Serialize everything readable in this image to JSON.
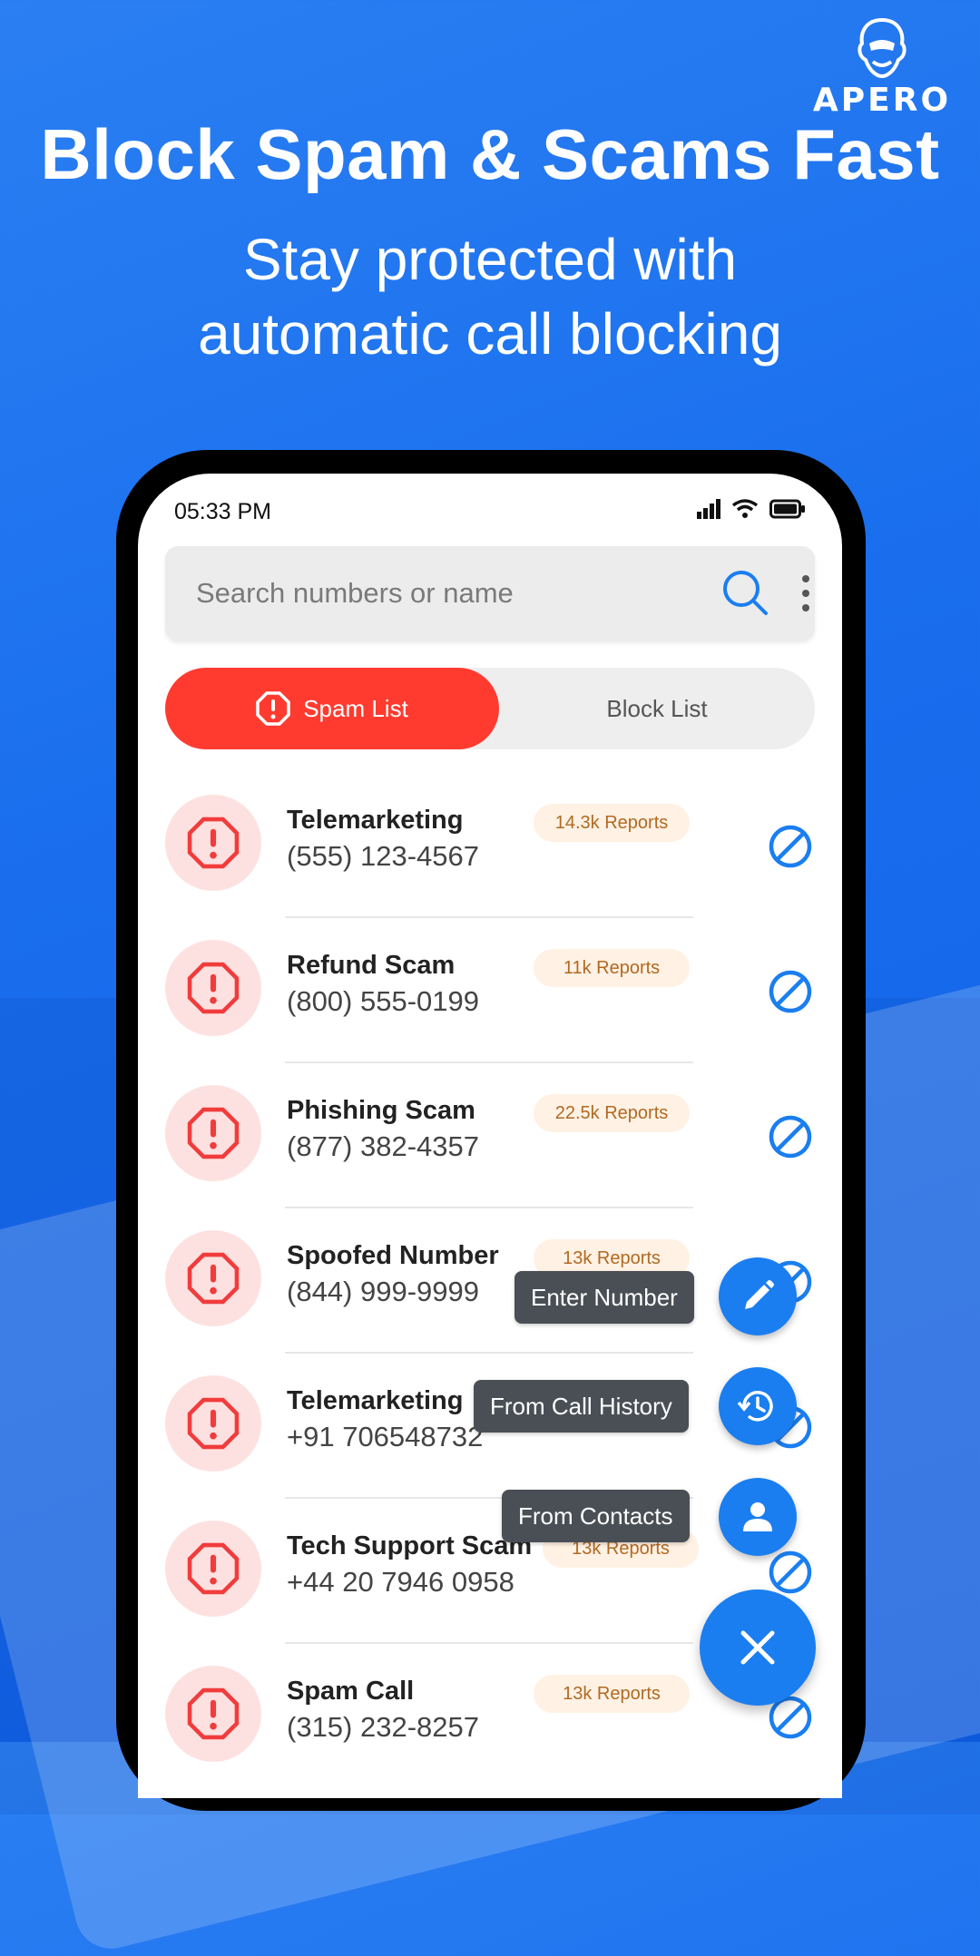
{
  "brand": {
    "name": "APERO"
  },
  "hero": {
    "headline": "Block Spam & Scams Fast",
    "subline_1": "Stay protected with",
    "subline_2": "automatic call blocking"
  },
  "status_bar": {
    "time": "05:33 PM"
  },
  "search": {
    "placeholder": "Search numbers or name"
  },
  "tabs": {
    "active": "Spam List",
    "inactive": "Block List"
  },
  "spam_list": [
    {
      "name": "Telemarketing",
      "number": "(555) 123-4567",
      "reports": "14.3k Reports"
    },
    {
      "name": "Refund Scam",
      "number": "(800) 555-0199",
      "reports": "11k Reports"
    },
    {
      "name": "Phishing Scam",
      "number": "(877) 382-4357",
      "reports": "22.5k Reports"
    },
    {
      "name": "Spoofed Number",
      "number": "(844) 999-9999",
      "reports": "13k Reports"
    },
    {
      "name": "Telemarketing",
      "number": "+91 706548732",
      "reports": ""
    },
    {
      "name": "Tech Support Scam",
      "number": "+44 20 7946 0958",
      "reports": "13k Reports"
    },
    {
      "name": "Spam Call",
      "number": "(315) 232-8257",
      "reports": "13k Reports"
    }
  ],
  "fab_menu": {
    "enter_number": "Enter Number",
    "from_call_history": "From Call History",
    "from_contacts": "From Contacts"
  },
  "colors": {
    "accent": "#1a7ef0",
    "spam_red": "#ff3b30",
    "badge_bg": "#fff1e3"
  }
}
